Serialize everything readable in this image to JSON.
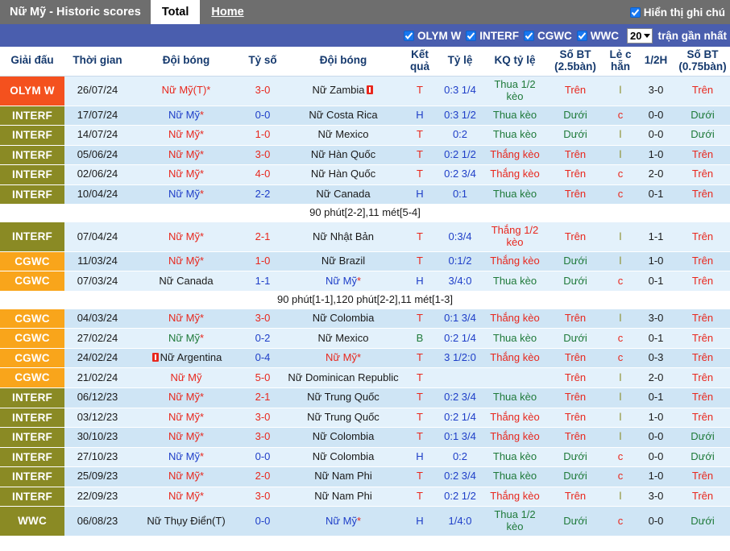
{
  "topbar": {
    "title": "Nữ Mỹ - Historic scores",
    "tab_total": "Total",
    "tab_home": "Home",
    "show_notes_label": "Hiển thị ghi chú",
    "show_notes_checked": true
  },
  "filterbar": {
    "leagues": [
      {
        "label": "OLYM W",
        "checked": true
      },
      {
        "label": "INTERF",
        "checked": true
      },
      {
        "label": "CGWC",
        "checked": true
      },
      {
        "label": "WWC",
        "checked": true
      }
    ],
    "count_value": "20",
    "count_suffix": "trận gần nhất"
  },
  "table": {
    "headers": [
      "Giải đấu",
      "Thời gian",
      "Đội bóng",
      "Tỷ số",
      "Đội bóng",
      "Kết quả",
      "Tỷ lệ",
      "KQ tỷ lệ",
      "Số BT (2.5bàn)",
      "Lẻ c hẵn",
      "1/2H",
      "Số BT (0.75bàn)"
    ],
    "rows": [
      {
        "kind": "match",
        "league": "OLYM W",
        "league_key": "OLYMW",
        "date": "26/07/24",
        "home": "Nữ Mỹ(T)*",
        "home_color": "red",
        "home_star": true,
        "home_card": false,
        "score": "3-0",
        "score_color": "red",
        "away": "Nữ Zambia",
        "away_color": "dark",
        "away_star": false,
        "away_card": true,
        "result": "T",
        "result_color": "red",
        "odds": "0:3 1/4",
        "odds_color": "blue",
        "odds_result": "Thua 1/2 kèo",
        "odds_result_color": "green",
        "ou": "Trên",
        "ou_color": "red",
        "oddeven": "l",
        "oddeven_color": "olive",
        "half": "3-0",
        "half_color": "dark",
        "ou2": "Trên",
        "ou2_color": "red"
      },
      {
        "kind": "match",
        "league": "INTERF",
        "league_key": "INTERF",
        "date": "17/07/24",
        "home": "Nữ Mỹ*",
        "home_color": "blue",
        "home_star": true,
        "home_card": false,
        "score": "0-0",
        "score_color": "blue",
        "away": "Nữ Costa Rica",
        "away_color": "dark",
        "away_star": false,
        "away_card": false,
        "result": "H",
        "result_color": "blue",
        "odds": "0:3 1/2",
        "odds_color": "blue",
        "odds_result": "Thua kèo",
        "odds_result_color": "green",
        "ou": "Dưới",
        "ou_color": "green",
        "oddeven": "c",
        "oddeven_color": "red",
        "half": "0-0",
        "half_color": "dark",
        "ou2": "Dưới",
        "ou2_color": "green"
      },
      {
        "kind": "match",
        "league": "INTERF",
        "league_key": "INTERF",
        "date": "14/07/24",
        "home": "Nữ Mỹ*",
        "home_color": "red",
        "home_star": true,
        "home_card": false,
        "score": "1-0",
        "score_color": "red",
        "away": "Nữ Mexico",
        "away_color": "dark",
        "away_star": false,
        "away_card": false,
        "result": "T",
        "result_color": "red",
        "odds": "0:2",
        "odds_color": "blue",
        "odds_result": "Thua kèo",
        "odds_result_color": "green",
        "ou": "Dưới",
        "ou_color": "green",
        "oddeven": "l",
        "oddeven_color": "olive",
        "half": "0-0",
        "half_color": "dark",
        "ou2": "Dưới",
        "ou2_color": "green"
      },
      {
        "kind": "match",
        "league": "INTERF",
        "league_key": "INTERF",
        "date": "05/06/24",
        "home": "Nữ Mỹ*",
        "home_color": "red",
        "home_star": true,
        "home_card": false,
        "score": "3-0",
        "score_color": "red",
        "away": "Nữ Hàn Quốc",
        "away_color": "dark",
        "away_star": false,
        "away_card": false,
        "result": "T",
        "result_color": "red",
        "odds": "0:2 1/2",
        "odds_color": "blue",
        "odds_result": "Thắng kèo",
        "odds_result_color": "red",
        "ou": "Trên",
        "ou_color": "red",
        "oddeven": "l",
        "oddeven_color": "olive",
        "half": "1-0",
        "half_color": "dark",
        "ou2": "Trên",
        "ou2_color": "red"
      },
      {
        "kind": "match",
        "league": "INTERF",
        "league_key": "INTERF",
        "date": "02/06/24",
        "home": "Nữ Mỹ*",
        "home_color": "red",
        "home_star": true,
        "home_card": false,
        "score": "4-0",
        "score_color": "red",
        "away": "Nữ Hàn Quốc",
        "away_color": "dark",
        "away_star": false,
        "away_card": false,
        "result": "T",
        "result_color": "red",
        "odds": "0:2 3/4",
        "odds_color": "blue",
        "odds_result": "Thắng kèo",
        "odds_result_color": "red",
        "ou": "Trên",
        "ou_color": "red",
        "oddeven": "c",
        "oddeven_color": "red",
        "half": "2-0",
        "half_color": "dark",
        "ou2": "Trên",
        "ou2_color": "red"
      },
      {
        "kind": "match",
        "league": "INTERF",
        "league_key": "INTERF",
        "date": "10/04/24",
        "home": "Nữ Mỹ*",
        "home_color": "blue",
        "home_star": true,
        "home_card": false,
        "score": "2-2",
        "score_color": "blue",
        "away": "Nữ Canada",
        "away_color": "dark",
        "away_star": false,
        "away_card": false,
        "result": "H",
        "result_color": "blue",
        "odds": "0:1",
        "odds_color": "blue",
        "odds_result": "Thua kèo",
        "odds_result_color": "green",
        "ou": "Trên",
        "ou_color": "red",
        "oddeven": "c",
        "oddeven_color": "red",
        "half": "0-1",
        "half_color": "dark",
        "ou2": "Trên",
        "ou2_color": "red"
      },
      {
        "kind": "note",
        "text": "90 phút[2-2],11 mét[5-4]"
      },
      {
        "kind": "match",
        "league": "INTERF",
        "league_key": "INTERF",
        "date": "07/04/24",
        "home": "Nữ Mỹ*",
        "home_color": "red",
        "home_star": true,
        "home_card": false,
        "score": "2-1",
        "score_color": "red",
        "away": "Nữ Nhật Bản",
        "away_color": "dark",
        "away_star": false,
        "away_card": false,
        "result": "T",
        "result_color": "red",
        "odds": "0:3/4",
        "odds_color": "blue",
        "odds_result": "Thắng 1/2 kèo",
        "odds_result_color": "red",
        "ou": "Trên",
        "ou_color": "red",
        "oddeven": "l",
        "oddeven_color": "olive",
        "half": "1-1",
        "half_color": "dark",
        "ou2": "Trên",
        "ou2_color": "red"
      },
      {
        "kind": "match",
        "league": "CGWC",
        "league_key": "CGWC",
        "date": "11/03/24",
        "home": "Nữ Mỹ*",
        "home_color": "red",
        "home_star": true,
        "home_card": false,
        "score": "1-0",
        "score_color": "red",
        "away": "Nữ Brazil",
        "away_color": "dark",
        "away_star": false,
        "away_card": false,
        "result": "T",
        "result_color": "red",
        "odds": "0:1/2",
        "odds_color": "blue",
        "odds_result": "Thắng kèo",
        "odds_result_color": "red",
        "ou": "Dưới",
        "ou_color": "green",
        "oddeven": "l",
        "oddeven_color": "olive",
        "half": "1-0",
        "half_color": "dark",
        "ou2": "Trên",
        "ou2_color": "red"
      },
      {
        "kind": "match",
        "league": "CGWC",
        "league_key": "CGWC",
        "date": "07/03/24",
        "home": "Nữ Canada",
        "home_color": "dark",
        "home_star": false,
        "home_card": false,
        "score": "1-1",
        "score_color": "blue",
        "away": "Nữ Mỹ*",
        "away_color": "blue",
        "away_star": true,
        "away_card": false,
        "result": "H",
        "result_color": "blue",
        "odds": "3/4:0",
        "odds_color": "blue",
        "odds_result": "Thua kèo",
        "odds_result_color": "green",
        "ou": "Dưới",
        "ou_color": "green",
        "oddeven": "c",
        "oddeven_color": "red",
        "half": "0-1",
        "half_color": "dark",
        "ou2": "Trên",
        "ou2_color": "red"
      },
      {
        "kind": "note",
        "text": "90 phút[1-1],120 phút[2-2],11 mét[1-3]"
      },
      {
        "kind": "match",
        "league": "CGWC",
        "league_key": "CGWC",
        "date": "04/03/24",
        "home": "Nữ Mỹ*",
        "home_color": "red",
        "home_star": true,
        "home_card": false,
        "score": "3-0",
        "score_color": "red",
        "away": "Nữ Colombia",
        "away_color": "dark",
        "away_star": false,
        "away_card": false,
        "result": "T",
        "result_color": "red",
        "odds": "0:1 3/4",
        "odds_color": "blue",
        "odds_result": "Thắng kèo",
        "odds_result_color": "red",
        "ou": "Trên",
        "ou_color": "red",
        "oddeven": "l",
        "oddeven_color": "olive",
        "half": "3-0",
        "half_color": "dark",
        "ou2": "Trên",
        "ou2_color": "red"
      },
      {
        "kind": "match",
        "league": "CGWC",
        "league_key": "CGWC",
        "date": "27/02/24",
        "home": "Nữ Mỹ*",
        "home_color": "green",
        "home_star": true,
        "home_card": false,
        "score": "0-2",
        "score_color": "blue",
        "away": "Nữ Mexico",
        "away_color": "dark",
        "away_star": false,
        "away_card": false,
        "result": "B",
        "result_color": "green",
        "odds": "0:2 1/4",
        "odds_color": "blue",
        "odds_result": "Thua kèo",
        "odds_result_color": "green",
        "ou": "Dưới",
        "ou_color": "green",
        "oddeven": "c",
        "oddeven_color": "red",
        "half": "0-1",
        "half_color": "dark",
        "ou2": "Trên",
        "ou2_color": "red"
      },
      {
        "kind": "match",
        "league": "CGWC",
        "league_key": "CGWC",
        "date": "24/02/24",
        "home": "Nữ Argentina",
        "home_color": "dark",
        "home_star": false,
        "home_card": true,
        "score": "0-4",
        "score_color": "blue",
        "away": "Nữ Mỹ*",
        "away_color": "red",
        "away_star": true,
        "away_card": false,
        "result": "T",
        "result_color": "red",
        "odds": "3 1/2:0",
        "odds_color": "blue",
        "odds_result": "Thắng kèo",
        "odds_result_color": "red",
        "ou": "Trên",
        "ou_color": "red",
        "oddeven": "c",
        "oddeven_color": "red",
        "half": "0-3",
        "half_color": "dark",
        "ou2": "Trên",
        "ou2_color": "red"
      },
      {
        "kind": "match",
        "league": "CGWC",
        "league_key": "CGWC",
        "date": "21/02/24",
        "home": "Nữ Mỹ",
        "home_color": "red",
        "home_star": false,
        "home_card": false,
        "score": "5-0",
        "score_color": "red",
        "away": "Nữ Dominican Republic",
        "away_color": "dark",
        "away_star": false,
        "away_card": false,
        "result": "T",
        "result_color": "red",
        "odds": "",
        "odds_color": "blue",
        "odds_result": "",
        "odds_result_color": "green",
        "ou": "Trên",
        "ou_color": "red",
        "oddeven": "l",
        "oddeven_color": "olive",
        "half": "2-0",
        "half_color": "dark",
        "ou2": "Trên",
        "ou2_color": "red"
      },
      {
        "kind": "match",
        "league": "INTERF",
        "league_key": "INTERF",
        "date": "06/12/23",
        "home": "Nữ Mỹ*",
        "home_color": "red",
        "home_star": true,
        "home_card": false,
        "score": "2-1",
        "score_color": "red",
        "away": "Nữ Trung Quốc",
        "away_color": "dark",
        "away_star": false,
        "away_card": false,
        "result": "T",
        "result_color": "red",
        "odds": "0:2 3/4",
        "odds_color": "blue",
        "odds_result": "Thua kèo",
        "odds_result_color": "green",
        "ou": "Trên",
        "ou_color": "red",
        "oddeven": "l",
        "oddeven_color": "olive",
        "half": "0-1",
        "half_color": "dark",
        "ou2": "Trên",
        "ou2_color": "red"
      },
      {
        "kind": "match",
        "league": "INTERF",
        "league_key": "INTERF",
        "date": "03/12/23",
        "home": "Nữ Mỹ*",
        "home_color": "red",
        "home_star": true,
        "home_card": false,
        "score": "3-0",
        "score_color": "red",
        "away": "Nữ Trung Quốc",
        "away_color": "dark",
        "away_star": false,
        "away_card": false,
        "result": "T",
        "result_color": "red",
        "odds": "0:2 1/4",
        "odds_color": "blue",
        "odds_result": "Thắng kèo",
        "odds_result_color": "red",
        "ou": "Trên",
        "ou_color": "red",
        "oddeven": "l",
        "oddeven_color": "olive",
        "half": "1-0",
        "half_color": "dark",
        "ou2": "Trên",
        "ou2_color": "red"
      },
      {
        "kind": "match",
        "league": "INTERF",
        "league_key": "INTERF",
        "date": "30/10/23",
        "home": "Nữ Mỹ*",
        "home_color": "red",
        "home_star": true,
        "home_card": false,
        "score": "3-0",
        "score_color": "red",
        "away": "Nữ Colombia",
        "away_color": "dark",
        "away_star": false,
        "away_card": false,
        "result": "T",
        "result_color": "red",
        "odds": "0:1 3/4",
        "odds_color": "blue",
        "odds_result": "Thắng kèo",
        "odds_result_color": "red",
        "ou": "Trên",
        "ou_color": "red",
        "oddeven": "l",
        "oddeven_color": "olive",
        "half": "0-0",
        "half_color": "dark",
        "ou2": "Dưới",
        "ou2_color": "green"
      },
      {
        "kind": "match",
        "league": "INTERF",
        "league_key": "INTERF",
        "date": "27/10/23",
        "home": "Nữ Mỹ*",
        "home_color": "blue",
        "home_star": true,
        "home_card": false,
        "score": "0-0",
        "score_color": "blue",
        "away": "Nữ Colombia",
        "away_color": "dark",
        "away_star": false,
        "away_card": false,
        "result": "H",
        "result_color": "blue",
        "odds": "0:2",
        "odds_color": "blue",
        "odds_result": "Thua kèo",
        "odds_result_color": "green",
        "ou": "Dưới",
        "ou_color": "green",
        "oddeven": "c",
        "oddeven_color": "red",
        "half": "0-0",
        "half_color": "dark",
        "ou2": "Dưới",
        "ou2_color": "green"
      },
      {
        "kind": "match",
        "league": "INTERF",
        "league_key": "INTERF",
        "date": "25/09/23",
        "home": "Nữ Mỹ*",
        "home_color": "red",
        "home_star": true,
        "home_card": false,
        "score": "2-0",
        "score_color": "red",
        "away": "Nữ Nam Phi",
        "away_color": "dark",
        "away_star": false,
        "away_card": false,
        "result": "T",
        "result_color": "red",
        "odds": "0:2 3/4",
        "odds_color": "blue",
        "odds_result": "Thua kèo",
        "odds_result_color": "green",
        "ou": "Dưới",
        "ou_color": "green",
        "oddeven": "c",
        "oddeven_color": "red",
        "half": "1-0",
        "half_color": "dark",
        "ou2": "Trên",
        "ou2_color": "red"
      },
      {
        "kind": "match",
        "league": "INTERF",
        "league_key": "INTERF",
        "date": "22/09/23",
        "home": "Nữ Mỹ*",
        "home_color": "red",
        "home_star": true,
        "home_card": false,
        "score": "3-0",
        "score_color": "red",
        "away": "Nữ Nam Phi",
        "away_color": "dark",
        "away_star": false,
        "away_card": false,
        "result": "T",
        "result_color": "red",
        "odds": "0:2 1/2",
        "odds_color": "blue",
        "odds_result": "Thắng kèo",
        "odds_result_color": "red",
        "ou": "Trên",
        "ou_color": "red",
        "oddeven": "l",
        "oddeven_color": "olive",
        "half": "3-0",
        "half_color": "dark",
        "ou2": "Trên",
        "ou2_color": "red"
      },
      {
        "kind": "match",
        "league": "WWC",
        "league_key": "WWC",
        "date": "06/08/23",
        "home": "Nữ Thụy Điển(T)",
        "home_color": "dark",
        "home_star": false,
        "home_card": false,
        "score": "0-0",
        "score_color": "blue",
        "away": "Nữ Mỹ*",
        "away_color": "blue",
        "away_star": true,
        "away_card": false,
        "result": "H",
        "result_color": "blue",
        "odds": "1/4:0",
        "odds_color": "blue",
        "odds_result": "Thua 1/2 kèo",
        "odds_result_color": "green",
        "ou": "Dưới",
        "ou_color": "green",
        "oddeven": "c",
        "oddeven_color": "red",
        "half": "0-0",
        "half_color": "dark",
        "ou2": "Dưới",
        "ou2_color": "green"
      }
    ]
  }
}
